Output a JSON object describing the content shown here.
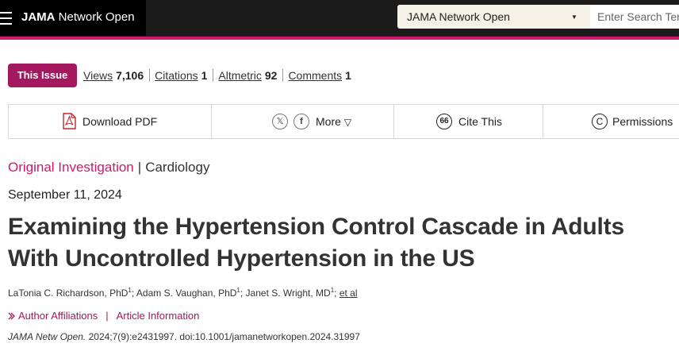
{
  "header": {
    "brand_bold": "JAMA",
    "brand_rest": " Network Open",
    "journal_select": "JAMA Network Open",
    "search_placeholder": "Enter Search Term"
  },
  "metrics": {
    "this_issue": "This Issue",
    "views_label": "Views",
    "views_value": "7,106",
    "citations_label": "Citations",
    "citations_value": "1",
    "altmetric_label": "Altmetric",
    "altmetric_value": "92",
    "comments_label": "Comments",
    "comments_value": "1"
  },
  "toolbar": {
    "download_pdf": "Download PDF",
    "x_icon": "𝕏",
    "facebook_icon": "f",
    "more": "More",
    "cite_icon": "66",
    "cite_this": "Cite This",
    "permissions_icon": "C",
    "permissions": "Permissions"
  },
  "article": {
    "type": "Original Investigation",
    "type_divider": "|",
    "subject": "Cardiology",
    "date": "September 11, 2024",
    "title": "Examining the Hypertension Control Cascade in Adults With Uncontrolled Hypertension in the US",
    "author1": "LaTonia C. Richardson, PhD",
    "author2": "Adam S. Vaughan, PhD",
    "author3": "Janet S. Wright, MD",
    "affiliation_mark": "1",
    "author_sep": "; ",
    "et_al": "et al",
    "author_affiliations": "Author Affiliations",
    "aff_separator": "|",
    "article_information": "Article Information",
    "journal_abbrev": "JAMA Netw Open.",
    "citation_rest": " 2024;7(9):e2431997. doi:10.1001/jamanetworkopen.2024.31997"
  },
  "colors": {
    "brand_pink": "#d0186d",
    "this_issue_bg": "#a4185f",
    "topbar": "#1b1b1b",
    "select_bg": "#f4f1e6"
  }
}
